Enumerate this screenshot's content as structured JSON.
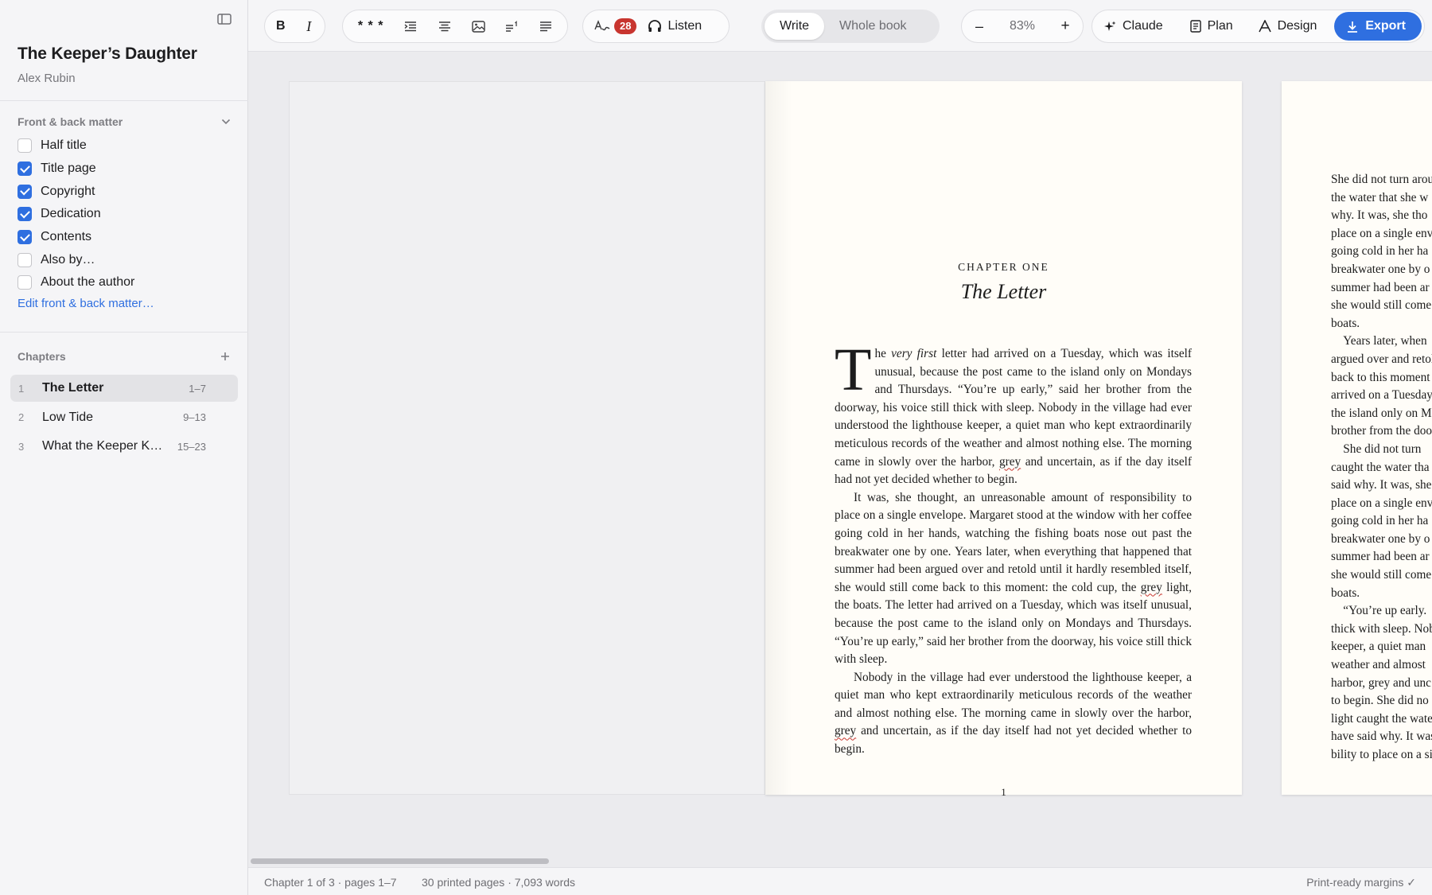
{
  "sidebar": {
    "book_title": "The Keeper’s Daughter",
    "author": "Alex Rubin",
    "matter_header": "Front & back matter",
    "matter": [
      {
        "label": "Half title",
        "checked": false
      },
      {
        "label": "Title page",
        "checked": true
      },
      {
        "label": "Copyright",
        "checked": true
      },
      {
        "label": "Dedication",
        "checked": true
      },
      {
        "label": "Contents",
        "checked": true
      },
      {
        "label": "Also by…",
        "checked": false
      },
      {
        "label": "About the author",
        "checked": false
      }
    ],
    "edit_link": "Edit front & back matter…",
    "chapters_header": "Chapters",
    "chapters": [
      {
        "num": "1",
        "title": "The Letter",
        "pages": "1–7",
        "active": true
      },
      {
        "num": "2",
        "title": "Low Tide",
        "pages": "9–13",
        "active": false
      },
      {
        "num": "3",
        "title": "What the Keeper K…",
        "pages": "15–23",
        "active": false
      }
    ]
  },
  "toolbar": {
    "bold": "B",
    "italic": "I",
    "scene_break": "* * *",
    "issues_count": "28",
    "listen": "Listen",
    "mode_write": "Write",
    "mode_whole": "Whole book",
    "zoom_minus": "–",
    "zoom": "83%",
    "zoom_plus": "+",
    "claude": "Claude",
    "plan": "Plan",
    "design": "Design",
    "export": "Export"
  },
  "page": {
    "chapter_label": "CHAPTER ONE",
    "chapter_title": "The Letter",
    "folio": "1"
  },
  "page2_lines": [
    "She did not turn arou",
    "the water that she w",
    "why. It was, she tho",
    "place on a single env",
    "going cold in her ha",
    "breakwater one by o",
    "summer had been ar",
    "she would still come",
    "boats.",
    "    Years later, when",
    "argued over and retol",
    "back to this moment",
    "arrived on a Tuesday",
    "the island only on M",
    "brother from the doo",
    "    She did not turn",
    "caught the water tha",
    "said why. It was, she t",
    "place on a single env",
    "going cold in her ha",
    "breakwater one by o",
    "summer had been ar",
    "she would still come",
    "boats.",
    "    “You’re up early.",
    "thick with sleep. Nob",
    "keeper, a quiet man",
    "weather and almost",
    "harbor, grey and unc",
    "to begin. She did no",
    "light caught the wate",
    "have said why. It was",
    "bility to place on a sin"
  ],
  "status": {
    "chapter_info": "Chapter 1 of 3 · pages 1–7",
    "word_info": "30 printed pages · 7,093 words",
    "margins": "Print-ready margins ✓"
  }
}
